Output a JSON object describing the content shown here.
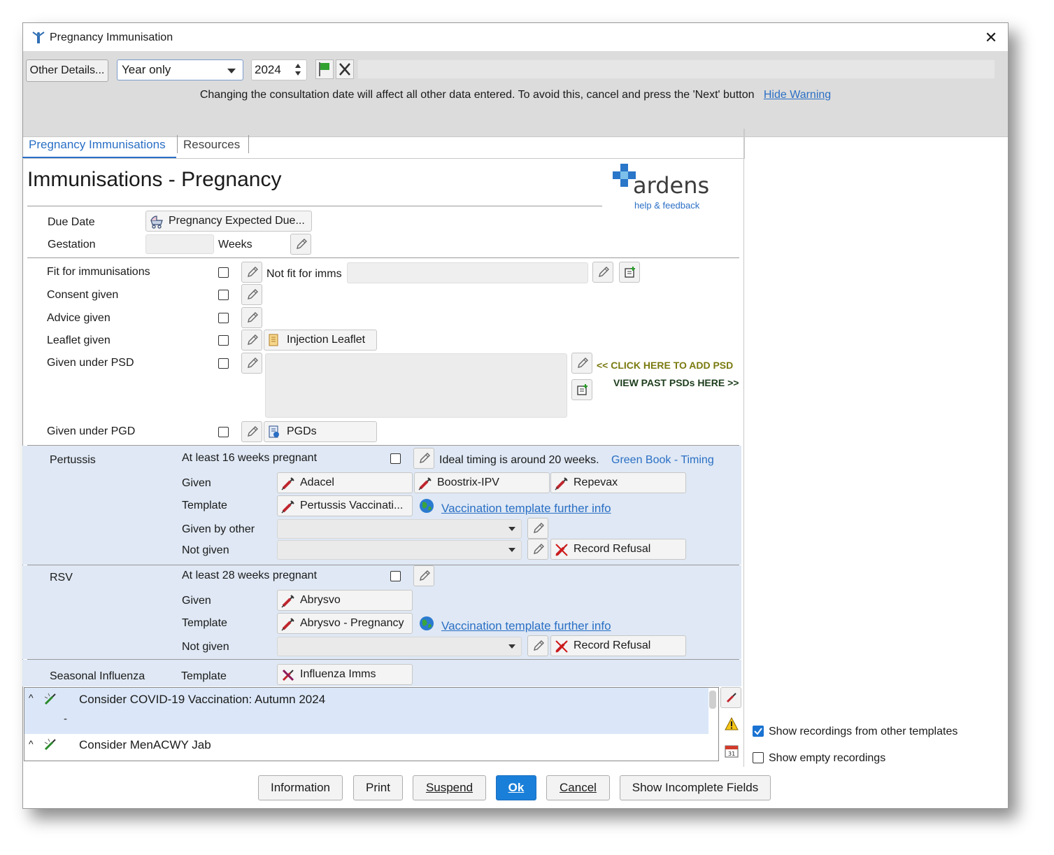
{
  "window": {
    "title": "Pregnancy Immunisation",
    "close": "✕"
  },
  "toolbar": {
    "other_details": "Other Details...",
    "date_mode": "Year only",
    "year": "2024",
    "warning_text": "Changing the consultation date will affect all other data entered. To avoid this, cancel and press the 'Next' button",
    "hide_warning": "Hide Warning"
  },
  "tabs": [
    {
      "label": "Pregnancy Immunisations",
      "active": true
    },
    {
      "label": "Resources",
      "active": false
    }
  ],
  "page": {
    "heading": "Immunisations - Pregnancy",
    "logo_text": "ardens",
    "logo_sub": "help & feedback"
  },
  "due": {
    "due_date_label": "Due Date",
    "due_date_button": "Pregnancy Expected Due...",
    "gestation_label": "Gestation",
    "weeks_label": "Weeks"
  },
  "checks": {
    "fit": "Fit for immunisations",
    "not_fit": "Not fit for imms",
    "consent": "Consent given",
    "advice": "Advice given",
    "leaflet": "Leaflet given",
    "injection_leaflet": "Injection Leaflet",
    "psd": "Given under PSD",
    "add_psd": "<< CLICK HERE TO ADD PSD",
    "view_psd": "VIEW PAST PSDs HERE >>",
    "pgd": "Given under PGD",
    "pgds_button": "PGDs"
  },
  "pertussis": {
    "section": "Pertussis",
    "at_least": "At least 16 weeks pregnant",
    "ideal_timing": "Ideal timing is around 20 weeks.",
    "green_book": "Green Book - Timing",
    "given_label": "Given",
    "given_options": [
      "Adacel",
      "Boostrix-IPV",
      "Repevax"
    ],
    "template_label": "Template",
    "template_button": "Pertussis Vaccinati...",
    "template_info": "Vaccination template further info",
    "given_by_other": "Given by other",
    "not_given": "Not given",
    "record_refusal": "Record Refusal"
  },
  "rsv": {
    "section": "RSV",
    "at_least": "At least 28 weeks pregnant",
    "given_label": "Given",
    "given_button": "Abrysvo",
    "template_label": "Template",
    "template_button": "Abrysvo - Pregnancy",
    "template_info": "Vaccination template further info",
    "not_given": "Not given",
    "record_refusal": "Record Refusal"
  },
  "influenza": {
    "section": "Seasonal Influenza",
    "template_label": "Template",
    "template_button": "Influenza Imms"
  },
  "suggestions": [
    {
      "text": "Consider COVID-19 Vaccination: Autumn 2024",
      "sub": "-"
    },
    {
      "text": "Consider MenACWY Jab",
      "sub": ""
    }
  ],
  "options": {
    "show_other": "Show recordings from other templates",
    "show_other_checked": true,
    "show_empty": "Show empty recordings",
    "show_empty_checked": false
  },
  "footer": {
    "information": "Information",
    "print": "Print",
    "suspend": "Suspend",
    "ok": "Ok",
    "cancel": "Cancel",
    "incomplete": "Show Incomplete Fields"
  },
  "colors": {
    "accent": "#0078d7",
    "link": "#2a6fc5",
    "section_bg": "#dfe8f4",
    "psd_link": "#7a7a10"
  }
}
